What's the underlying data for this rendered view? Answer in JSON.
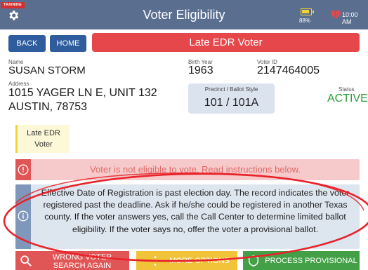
{
  "titlebar": {
    "training_label": "TRAINING",
    "title": "Voter Eligibility",
    "battery_text": "88%",
    "battery_level": 0.88,
    "clock": "10:00 AM"
  },
  "nav": {
    "back_label": "BACK",
    "home_label": "HOME",
    "banner": "Late EDR Voter"
  },
  "voter": {
    "name_label": "Name",
    "name": "SUSAN STORM",
    "birth_year_label": "Birth Year",
    "birth_year": "1963",
    "voter_id_label": "Voter ID",
    "voter_id": "2147464005",
    "address_label": "Address",
    "address_line1": "1015 YAGER LN E, UNIT 132",
    "address_line2": "AUSTIN, 78753",
    "precinct_label": "Precinct / Ballot Style",
    "precinct": "101 / 101A",
    "status_label": "Status",
    "status": "ACTIVE"
  },
  "tag": {
    "line1": "Late EDR",
    "line2": "Voter"
  },
  "alert": {
    "text": "Voter is not eligible to vote.  Read instructions below."
  },
  "info": {
    "text": "Effective Date of Registration is past election day. The record indicates the voter registered past the deadline. Ask if he/she could be registered in another Texas county. If the voter answers yes, call the Call Center to determine limited ballot eligibility. If the voter says no, offer the voter a provisional ballot."
  },
  "actions": {
    "wrong_voter_line1": "WRONG VOTER",
    "wrong_voter_line2": "SEARCH AGAIN",
    "more_options": "MORE OPTIONS",
    "process_provisional": "PROCESS PROVISIONAL"
  },
  "colors": {
    "titlebar": "#5a6e90",
    "banner": "#e5474a",
    "status": "#2e9a3a",
    "alert": "#f6cacb",
    "info": "#dde5ef",
    "annotation": "#e8232a"
  }
}
